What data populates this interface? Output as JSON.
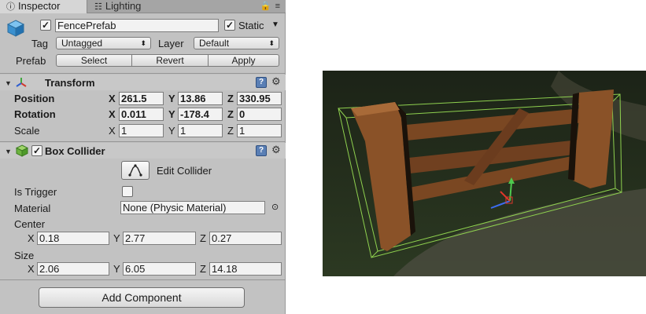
{
  "tabs": {
    "inspector": "Inspector",
    "lighting": "Lighting"
  },
  "header": {
    "object_name": "FencePrefab",
    "active_checked": "✓",
    "static_checked": "✓",
    "static_label": "Static",
    "tag_label": "Tag",
    "tag_value": "Untagged",
    "layer_label": "Layer",
    "layer_value": "Default",
    "prefab_label": "Prefab",
    "prefab_buttons": [
      "Select",
      "Revert",
      "Apply"
    ]
  },
  "transform": {
    "title": "Transform",
    "rows": [
      {
        "label": "Position",
        "x": "261.5",
        "y": "13.86",
        "z": "330.95"
      },
      {
        "label": "Rotation",
        "x": "0.011",
        "y": "-178.4",
        "z": "0"
      },
      {
        "label": "Scale",
        "x": "1",
        "y": "1",
        "z": "1"
      }
    ]
  },
  "box_collider": {
    "title": "Box Collider",
    "enabled_checked": "✓",
    "edit_collider_label": "Edit Collider",
    "is_trigger_label": "Is Trigger",
    "material_label": "Material",
    "material_value": "None (Physic Material)",
    "center_label": "Center",
    "center": {
      "x": "0.18",
      "y": "2.77",
      "z": "0.27"
    },
    "size_label": "Size",
    "size": {
      "x": "2.06",
      "y": "6.05",
      "z": "14.18"
    }
  },
  "axis_letters": {
    "x": "X",
    "y": "Y",
    "z": "Z"
  },
  "add_component_label": "Add Component",
  "colors": {
    "panel_bg": "#c2c2c2",
    "collider_wireframe": "#8fd14f",
    "fence_wood": "#7a4722",
    "grass": "#2b3622"
  }
}
